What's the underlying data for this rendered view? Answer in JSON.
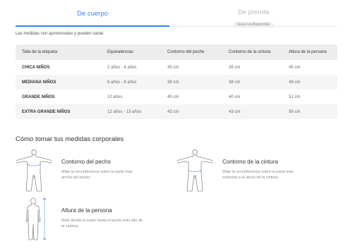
{
  "tabs": {
    "body_label": "De cuerpo",
    "garment_label": "De prenda",
    "garment_badge": "Guía no disponible"
  },
  "note": "Las medidas son aproximadas y pueden variar.",
  "table": {
    "headers": [
      "Talla de la etiqueta",
      "Equivalencias",
      "Contorno del pecho",
      "Contorno de la cintura",
      "Altura de la persona"
    ],
    "rows": [
      [
        "CHICA NIÑOS",
        "2 años - 4 años",
        "35 cm",
        "35 cm",
        "45 cm"
      ],
      [
        "MEDIANA NIÑOS",
        "6 años - 8 años",
        "38 cm",
        "38 cm",
        "49 cm"
      ],
      [
        "GRANDE NIÑOS",
        "10 años",
        "40 cm",
        "40 cm",
        "51 cm"
      ],
      [
        "EXTRA GRANDE NIÑOS",
        "12 años - 13 años",
        "43 cm",
        "43 cm",
        "56 cm"
      ]
    ]
  },
  "section_title": "Cómo tomar tus medidas corporales",
  "measures": {
    "chest": {
      "title": "Contorno del pecho",
      "desc": "Mide la circunferencia sobre la parte más ancha del pecho.",
      "icon": "chest-measure-figure-icon"
    },
    "waist": {
      "title": "Contorno de la cintura",
      "desc": "Mide la circunferencia sobre la parte más estrecha a la altura de la cintura.",
      "icon": "waist-measure-figure-icon"
    },
    "height": {
      "title": "Altura de la persona",
      "desc": "Mide desde el suelo hasta el punto más alto de la cabeza.",
      "icon": "height-measure-figure-icon"
    }
  },
  "colors": {
    "accent": "#3483fa",
    "measure_line": "#5b8ad9",
    "header_bg": "#ededed"
  }
}
